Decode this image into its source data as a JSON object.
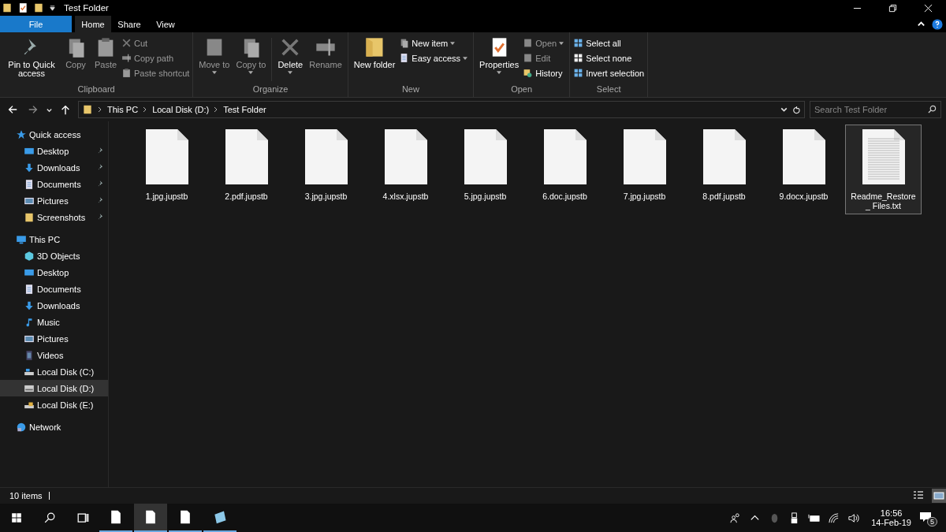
{
  "window": {
    "title": "Test Folder"
  },
  "tabs": [
    {
      "label": "File",
      "kind": "file",
      "selected": false
    },
    {
      "label": "Home",
      "kind": "tab",
      "selected": true
    },
    {
      "label": "Share",
      "kind": "tab",
      "selected": false
    },
    {
      "label": "View",
      "kind": "tab",
      "selected": false
    }
  ],
  "ribbon": {
    "groups": [
      {
        "label": "Clipboard",
        "items": [
          {
            "kind": "large",
            "label": "Pin to Quick access",
            "disabled": false,
            "dropdown": false
          },
          {
            "kind": "large",
            "label": "Copy",
            "disabled": true,
            "dropdown": false
          },
          {
            "kind": "large",
            "label": "Paste",
            "disabled": true,
            "dropdown": false
          },
          {
            "kind": "stack",
            "items": [
              {
                "label": "Cut",
                "disabled": true,
                "dropdown": false
              },
              {
                "label": "Copy path",
                "disabled": true,
                "dropdown": false
              },
              {
                "label": "Paste shortcut",
                "disabled": true,
                "dropdown": false
              }
            ]
          }
        ]
      },
      {
        "label": "Organize",
        "items": [
          {
            "kind": "large",
            "label": "Move to",
            "disabled": true,
            "dropdown": true
          },
          {
            "kind": "large",
            "label": "Copy to",
            "disabled": true,
            "dropdown": true
          },
          {
            "kind": "sep"
          },
          {
            "kind": "large",
            "label": "Delete",
            "disabled": false,
            "dropdown": true
          },
          {
            "kind": "large",
            "label": "Rename",
            "disabled": true,
            "dropdown": false
          }
        ]
      },
      {
        "label": "New",
        "items": [
          {
            "kind": "large",
            "label": "New folder",
            "disabled": false,
            "dropdown": false
          },
          {
            "kind": "stack",
            "items": [
              {
                "label": "New item",
                "disabled": false,
                "dropdown": true
              },
              {
                "label": "Easy access",
                "disabled": false,
                "dropdown": true
              }
            ]
          }
        ]
      },
      {
        "label": "Open",
        "items": [
          {
            "kind": "large",
            "label": "Properties",
            "disabled": false,
            "dropdown": true
          },
          {
            "kind": "stack",
            "items": [
              {
                "label": "Open",
                "disabled": true,
                "dropdown": true
              },
              {
                "label": "Edit",
                "disabled": true,
                "dropdown": false
              },
              {
                "label": "History",
                "disabled": false,
                "dropdown": false
              }
            ]
          }
        ]
      },
      {
        "label": "Select",
        "items": [
          {
            "kind": "stack",
            "items": [
              {
                "label": "Select all",
                "disabled": false,
                "dropdown": false
              },
              {
                "label": "Select none",
                "disabled": false,
                "dropdown": false
              },
              {
                "label": "Invert selection",
                "disabled": false,
                "dropdown": false
              }
            ]
          }
        ]
      }
    ]
  },
  "address": {
    "path": [
      "This PC",
      "Local Disk (D:)",
      "Test Folder"
    ],
    "search_placeholder": "Search Test Folder"
  },
  "sidebar": {
    "items": [
      {
        "label": "Quick access",
        "selected": false,
        "children": [
          {
            "label": "Desktop",
            "pinned": true,
            "selected": false
          },
          {
            "label": "Downloads",
            "pinned": true,
            "selected": false
          },
          {
            "label": "Documents",
            "pinned": true,
            "selected": false
          },
          {
            "label": "Pictures",
            "pinned": true,
            "selected": false
          },
          {
            "label": "Screenshots",
            "pinned": true,
            "selected": false
          }
        ]
      },
      {
        "label": "This PC",
        "selected": false,
        "children": [
          {
            "label": "3D Objects",
            "pinned": false,
            "selected": false
          },
          {
            "label": "Desktop",
            "pinned": false,
            "selected": false
          },
          {
            "label": "Documents",
            "pinned": false,
            "selected": false
          },
          {
            "label": "Downloads",
            "pinned": false,
            "selected": false
          },
          {
            "label": "Music",
            "pinned": false,
            "selected": false
          },
          {
            "label": "Pictures",
            "pinned": false,
            "selected": false
          },
          {
            "label": "Videos",
            "pinned": false,
            "selected": false
          },
          {
            "label": "Local Disk (C:)",
            "pinned": false,
            "selected": false
          },
          {
            "label": "Local Disk (D:)",
            "pinned": false,
            "selected": true
          },
          {
            "label": "Local Disk (E:)",
            "pinned": false,
            "selected": false
          }
        ]
      },
      {
        "label": "Network",
        "selected": false
      }
    ]
  },
  "files": [
    {
      "name": "1.jpg.jupstb",
      "kind": "blank",
      "selected": false
    },
    {
      "name": "2.pdf.jupstb",
      "kind": "blank",
      "selected": false
    },
    {
      "name": "3.jpg.jupstb",
      "kind": "blank",
      "selected": false
    },
    {
      "name": "4.xlsx.jupstb",
      "kind": "blank",
      "selected": false
    },
    {
      "name": "5.jpg.jupstb",
      "kind": "blank",
      "selected": false
    },
    {
      "name": "6.doc.jupstb",
      "kind": "blank",
      "selected": false
    },
    {
      "name": "7.jpg.jupstb",
      "kind": "blank",
      "selected": false
    },
    {
      "name": "8.pdf.jupstb",
      "kind": "blank",
      "selected": false
    },
    {
      "name": "9.docx.jupstb",
      "kind": "blank",
      "selected": false
    },
    {
      "name": "Readme_Restore_ Files.txt",
      "kind": "text",
      "selected": true
    }
  ],
  "status_bar": {
    "count": "10 items",
    "views": [
      {
        "kind": "details",
        "selected": false
      },
      {
        "kind": "large",
        "selected": true
      }
    ]
  },
  "taskbar": {
    "apps": [
      {
        "kind": "file",
        "selected": false
      },
      {
        "kind": "file",
        "selected": true
      },
      {
        "kind": "file",
        "selected": false
      },
      {
        "kind": "notepad",
        "selected": false
      }
    ],
    "time": "16:56",
    "date": "14-Feb-19",
    "notifications": "5"
  }
}
